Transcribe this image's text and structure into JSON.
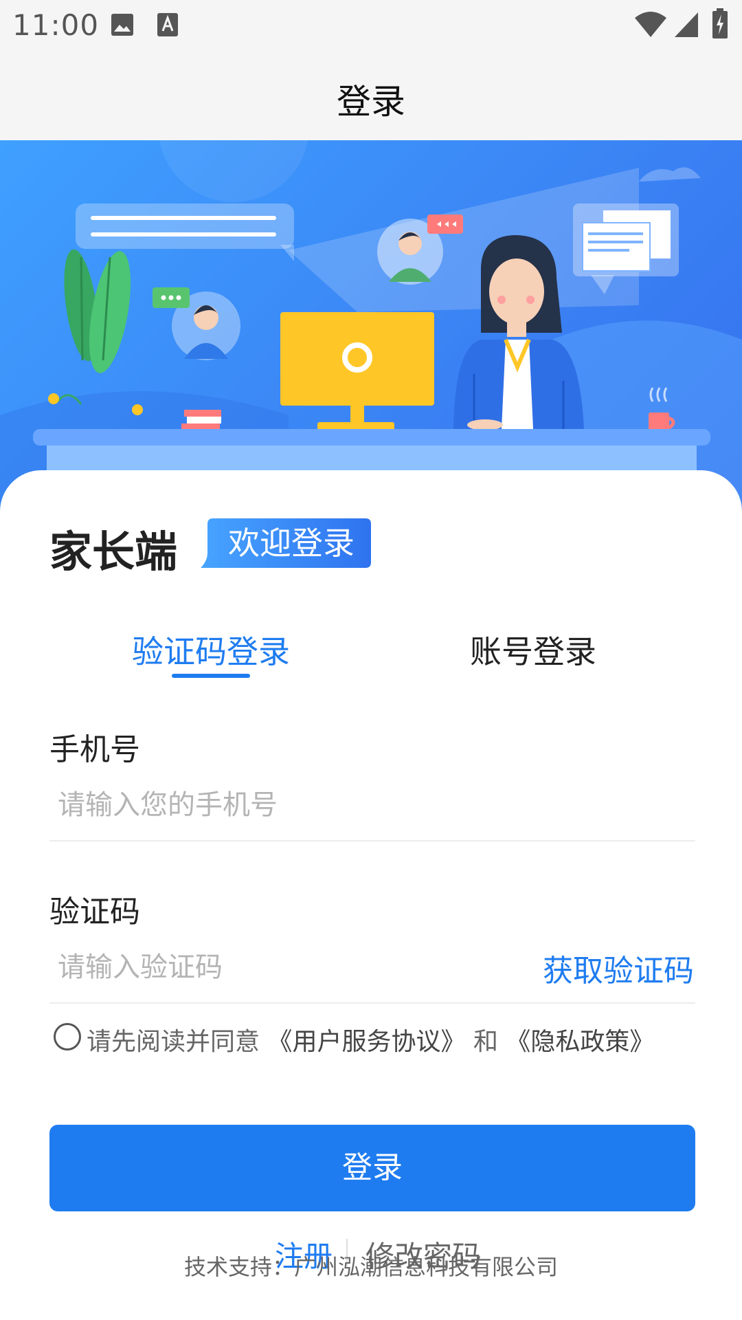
{
  "status_bar": {
    "time": "11:00",
    "icons": [
      "image-icon",
      "font-icon",
      "wifi-icon",
      "signal-icon",
      "battery-charging-icon"
    ]
  },
  "nav": {
    "title": "登录"
  },
  "hero": {
    "illustration": "customer-service-illustration"
  },
  "card": {
    "role_title": "家长端",
    "welcome_badge": "欢迎登录"
  },
  "tabs": [
    {
      "label": "验证码登录",
      "active": true
    },
    {
      "label": "账号登录",
      "active": false
    }
  ],
  "form": {
    "phone": {
      "label": "手机号",
      "placeholder": "请输入您的手机号",
      "value": ""
    },
    "code": {
      "label": "验证码",
      "placeholder": "请输入验证码",
      "value": "",
      "get_code_label": "获取验证码"
    }
  },
  "agreement": {
    "checked": false,
    "prefix": "请先阅读并同意",
    "terms": "《用户服务协议》",
    "and": "和",
    "privacy": "《隐私政策》"
  },
  "login_button": "登录",
  "links": {
    "register": "注册",
    "change_password": "修改密码"
  },
  "footer": "技术支持：广州泓潮信息科技有限公司",
  "colors": {
    "primary": "#1f7cf0",
    "hero_start": "#3fa0ff",
    "hero_end": "#3570ee",
    "yellow": "#ffc628"
  }
}
